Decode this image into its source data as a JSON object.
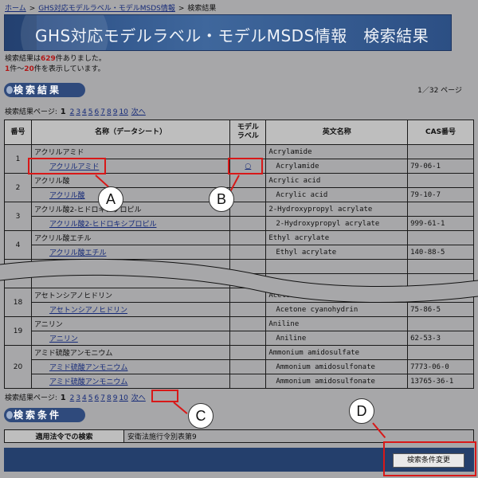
{
  "breadcrumb": {
    "home": "ホーム",
    "sep": ">",
    "parent": "GHS対応モデルラベル・モデルMSDS情報",
    "current": "検索結果"
  },
  "banner": {
    "title": "GHS対応モデルラベル・モデルMSDS情報　検索結果"
  },
  "summary": {
    "line1_pre": "検索結果は",
    "count": "629",
    "line1_post": "件ありました。",
    "from": "1",
    "line2_mid": "件～",
    "to": "20",
    "line2_post": "件を表示しています。"
  },
  "results_heading": "検索結果",
  "page_info": "1／32 ページ",
  "pager": {
    "label": "検索結果ページ:",
    "current": "1",
    "pages": [
      "2",
      "3",
      "4",
      "5",
      "6",
      "7",
      "8",
      "9",
      "10"
    ],
    "next": "次へ"
  },
  "table": {
    "headers": {
      "no": "番号",
      "name": "名称（データシート）",
      "model_label": "モデル\nラベル",
      "english": "英文名称",
      "cas": "CAS番号"
    },
    "rows_top": [
      {
        "no": "1",
        "name": "アクリルアミド",
        "sheet": "アクリルアミド",
        "label": "○",
        "en": "Acrylamide",
        "en_sub": "Acrylamide",
        "cas": "79-06-1"
      },
      {
        "no": "2",
        "name": "アクリル酸",
        "sheet": "アクリル酸",
        "label": "",
        "en": "Acrylic acid",
        "en_sub": "Acrylic acid",
        "cas": "79-10-7"
      },
      {
        "no": "3",
        "name": "アクリル酸2-ヒドロキシプロピル",
        "sheet": "アクリル酸2-ヒドロキシプロピル",
        "label": "",
        "en": "2-Hydroxypropyl acrylate",
        "en_sub": "2-Hydroxypropyl acrylate",
        "cas": "999-61-1"
      },
      {
        "no": "4",
        "name": "アクリル酸エチル",
        "sheet": "アクリル酸エチル",
        "label": "",
        "en": "Ethyl acrylate",
        "en_sub": "Ethyl acrylate",
        "cas": "140-88-5"
      }
    ],
    "rows_bottom": [
      {
        "no": "18",
        "name": "アセトンシアノヒドリン",
        "sheet": "アセトンシアノヒドリン",
        "en": "Acetone cyanohydrin",
        "en_sub": "Acetone cyanohydrin",
        "cas": "75-86-5"
      },
      {
        "no": "19",
        "name": "アニリン",
        "sheet": "アニリン",
        "en": "Aniline",
        "en_sub": "Aniline",
        "cas": "62-53-3"
      }
    ],
    "row20": {
      "no": "20",
      "name": "アミド硫酸アンモニウム",
      "sheet1": "アミド硫酸アンモニウム",
      "sheet2": "アミド硫酸アンモニウム",
      "en": "Ammonium amidosulfate",
      "en_sub1": "Ammonium amidosulfonate",
      "en_sub2": "Ammonium amidosulfonate",
      "cas1": "7773-06-0",
      "cas2": "13765-36-1"
    }
  },
  "conditions_heading": "検索条件",
  "conditions": {
    "label": "適用法令での検索",
    "value": "安衛法施行令別表第9"
  },
  "change_button": "検索条件変更",
  "callouts": {
    "a": "A",
    "b": "B",
    "c": "C",
    "d": "D"
  },
  "colors": {
    "banner": "#2f5288",
    "section": "#2f4a7c",
    "link": "#152a78",
    "highlight": "#d81818"
  }
}
